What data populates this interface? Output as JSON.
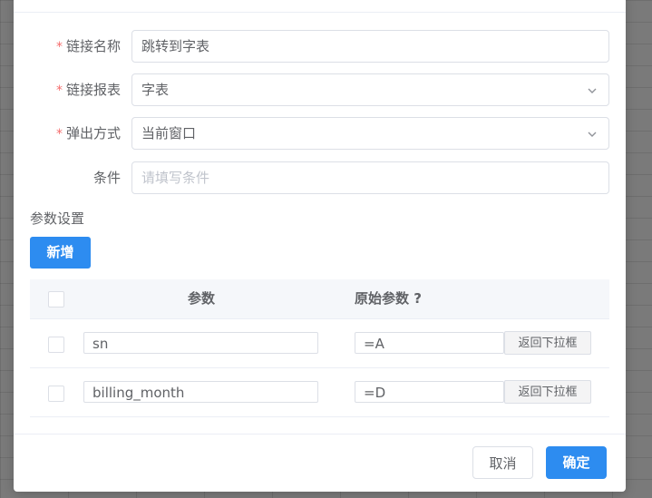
{
  "form": {
    "link_name": {
      "label": "链接名称",
      "required_mark": "*",
      "value": "跳转到字表"
    },
    "link_report": {
      "label": "链接报表",
      "required_mark": "*",
      "value": "字表"
    },
    "popup_mode": {
      "label": "弹出方式",
      "required_mark": "*",
      "value": "当前窗口"
    },
    "condition": {
      "label": "条件",
      "placeholder": "请填写条件"
    }
  },
  "params": {
    "section_title": "参数设置",
    "add_label": "新增",
    "headers": {
      "param": "参数",
      "source": "原始参数 ?"
    },
    "rows": [
      {
        "param": "sn",
        "source": "=A",
        "action": "返回下拉框"
      },
      {
        "param": "billing_month",
        "source": "=D",
        "action": "返回下拉框"
      }
    ]
  },
  "footer": {
    "cancel_label": "取消",
    "ok_label": "确定"
  },
  "colors": {
    "primary": "#2d8cf0",
    "required": "#f56c6c"
  }
}
